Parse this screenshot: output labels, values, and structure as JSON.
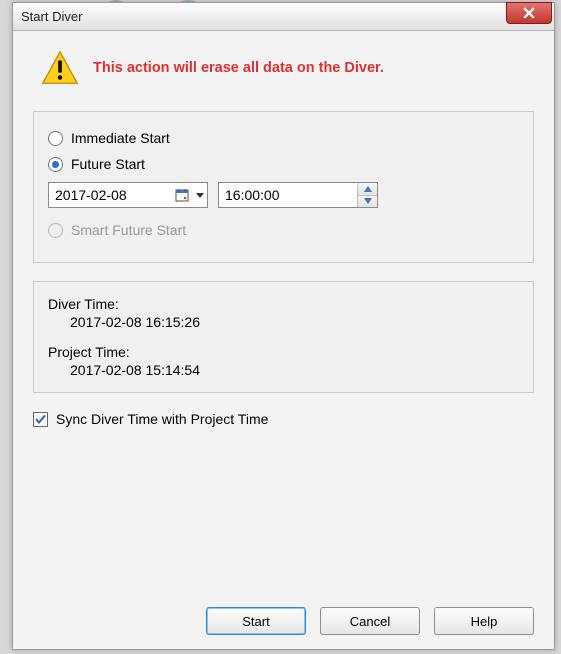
{
  "window": {
    "title": "Start Diver"
  },
  "warning": {
    "text": "This action will erase all data on the Diver."
  },
  "start_options": {
    "immediate": {
      "label": "Immediate Start",
      "selected": false
    },
    "future": {
      "label": "Future Start",
      "selected": true
    },
    "smart": {
      "label": "Smart Future Start",
      "selected": false,
      "disabled": true
    },
    "date": "2017-02-08",
    "time": "16:00:00"
  },
  "times": {
    "diver_label": "Diver Time:",
    "diver_value": "2017-02-08 16:15:26",
    "project_label": "Project Time:",
    "project_value": "2017-02-08 15:14:54"
  },
  "sync": {
    "label": "Sync Diver Time with Project Time",
    "checked": true
  },
  "buttons": {
    "start": "Start",
    "cancel": "Cancel",
    "help": "Help"
  }
}
